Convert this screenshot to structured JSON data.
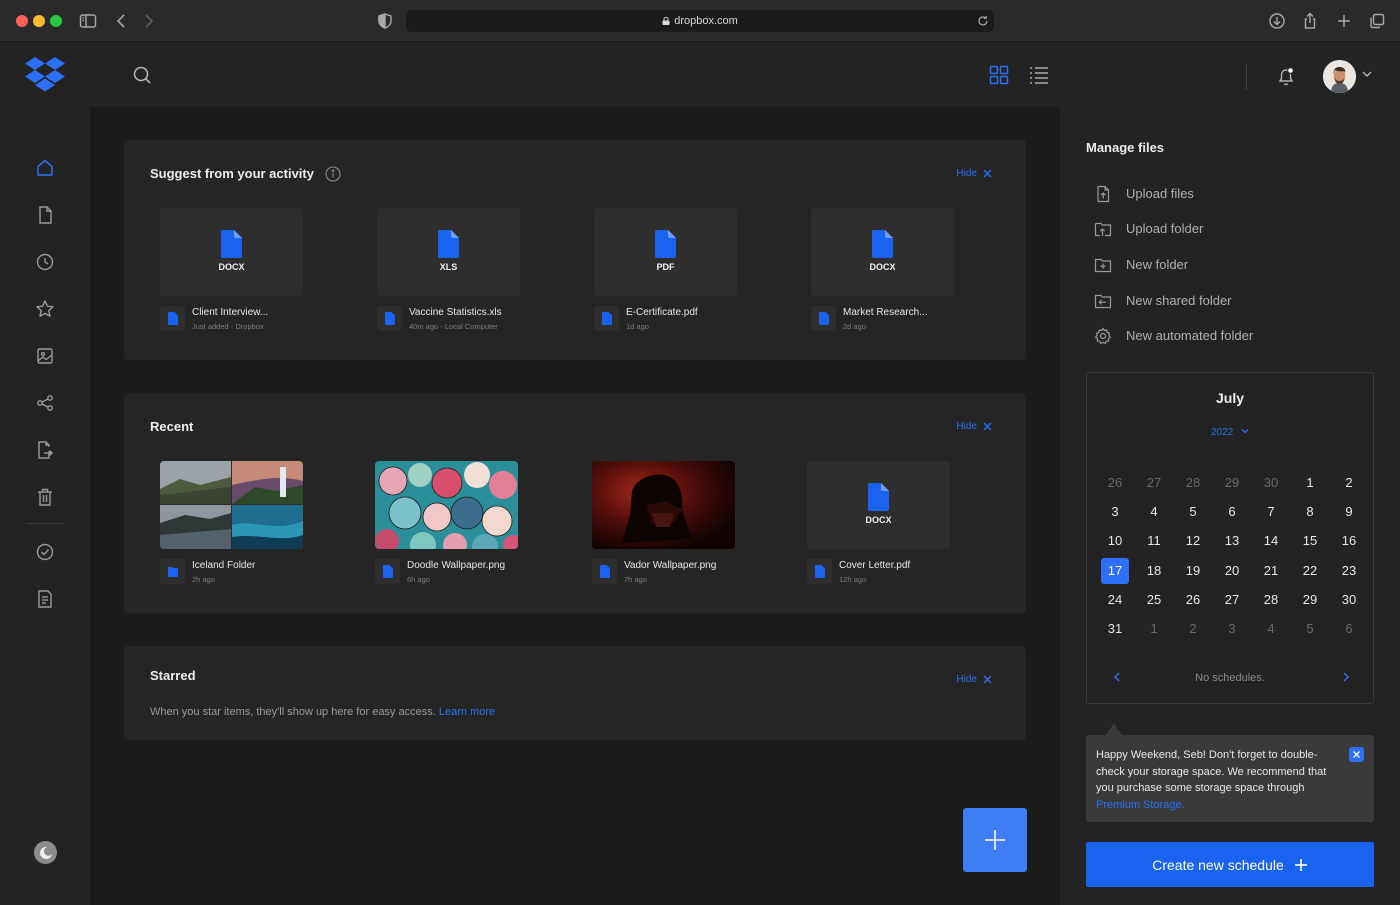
{
  "browser": {
    "url": "dropbox.com"
  },
  "colors": {
    "accent": "#2d6ff7",
    "background": "#1b1b1b",
    "panel": "#232323",
    "card": "#252525"
  },
  "sidebar": {
    "items": [
      {
        "icon": "home-icon",
        "active": true
      },
      {
        "icon": "file-icon"
      },
      {
        "icon": "clock-icon"
      },
      {
        "icon": "star-icon"
      },
      {
        "icon": "image-icon"
      },
      {
        "icon": "share-icon"
      },
      {
        "icon": "file-request-icon"
      },
      {
        "icon": "trash-icon"
      },
      {
        "icon": "check-circle-icon"
      },
      {
        "icon": "document-icon"
      }
    ]
  },
  "suggest": {
    "title": "Suggest from your activity",
    "hide_label": "Hide",
    "files": [
      {
        "ext": "DOCX",
        "name": "Client Interview...",
        "meta": "Just added - Dropbox"
      },
      {
        "ext": "XLS",
        "name": "Vaccine Statistics.xls",
        "meta": "40m ago - Local Computer"
      },
      {
        "ext": "PDF",
        "name": "E-Certificate.pdf",
        "meta": "1d ago"
      },
      {
        "ext": "DOCX",
        "name": "Market Research...",
        "meta": "2d ago"
      }
    ]
  },
  "recent": {
    "title": "Recent",
    "hide_label": "Hide",
    "files": [
      {
        "name": "Iceland Folder",
        "meta": "2h ago"
      },
      {
        "name": "Doodle Wallpaper.png",
        "meta": "6h ago"
      },
      {
        "name": "Vador Wallpaper.png",
        "meta": "7h ago"
      },
      {
        "ext": "DOCX",
        "name": "Cover Letter.pdf",
        "meta": "12h ago"
      }
    ]
  },
  "starred": {
    "title": "Starred",
    "hide_label": "Hide",
    "text": "When you star items, they'll show up here for easy access.",
    "link": "Learn more"
  },
  "manage": {
    "title": "Manage files",
    "items": [
      {
        "label": "Upload files",
        "icon": "upload-file-icon"
      },
      {
        "label": "Upload folder",
        "icon": "upload-folder-icon"
      },
      {
        "label": "New folder",
        "icon": "new-folder-icon"
      },
      {
        "label": "New shared folder",
        "icon": "shared-folder-icon"
      },
      {
        "label": "New automated folder",
        "icon": "gear-icon"
      }
    ]
  },
  "calendar": {
    "month": "July",
    "year": "2022",
    "days": [
      {
        "d": "26",
        "m": true
      },
      {
        "d": "27",
        "m": true
      },
      {
        "d": "28",
        "m": true
      },
      {
        "d": "29",
        "m": true
      },
      {
        "d": "30",
        "m": true
      },
      {
        "d": "1"
      },
      {
        "d": "2"
      },
      {
        "d": "3"
      },
      {
        "d": "4"
      },
      {
        "d": "5"
      },
      {
        "d": "6"
      },
      {
        "d": "7"
      },
      {
        "d": "8"
      },
      {
        "d": "9"
      },
      {
        "d": "10"
      },
      {
        "d": "11"
      },
      {
        "d": "12"
      },
      {
        "d": "13"
      },
      {
        "d": "14"
      },
      {
        "d": "15"
      },
      {
        "d": "16"
      },
      {
        "d": "17",
        "today": true
      },
      {
        "d": "18"
      },
      {
        "d": "19"
      },
      {
        "d": "20"
      },
      {
        "d": "21"
      },
      {
        "d": "22"
      },
      {
        "d": "23"
      },
      {
        "d": "24"
      },
      {
        "d": "25"
      },
      {
        "d": "26"
      },
      {
        "d": "27"
      },
      {
        "d": "28"
      },
      {
        "d": "29"
      },
      {
        "d": "30"
      },
      {
        "d": "31"
      },
      {
        "d": "1",
        "m": true
      },
      {
        "d": "2",
        "m": true
      },
      {
        "d": "3",
        "m": true
      },
      {
        "d": "4",
        "m": true
      },
      {
        "d": "5",
        "m": true
      },
      {
        "d": "6",
        "m": true
      }
    ],
    "empty": "No schedules."
  },
  "toast": {
    "text": "Happy Weekend, Seb! Don't forget to double-check your storage space. We recommend that you purchase some storage space through",
    "link": "Premium Storage."
  },
  "cta": {
    "label": "Create new schedule"
  }
}
